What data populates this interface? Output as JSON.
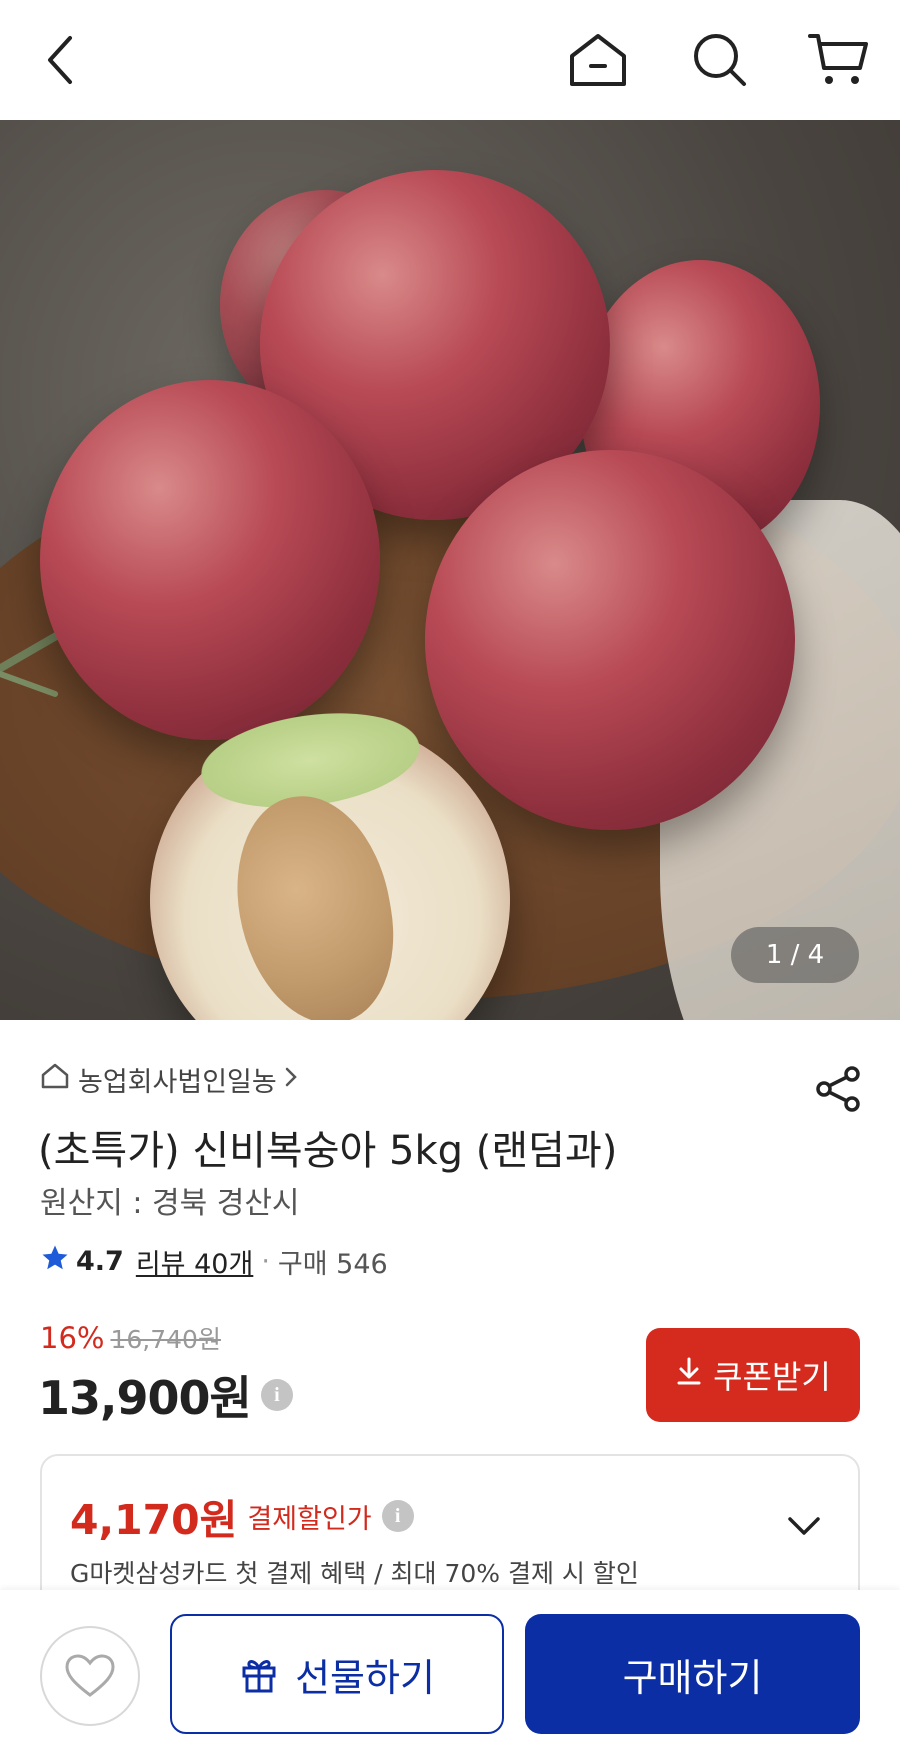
{
  "header": {
    "icons": [
      "back-arrow-icon",
      "home-icon",
      "search-icon",
      "cart-icon"
    ]
  },
  "gallery": {
    "counter": "1 / 4"
  },
  "product": {
    "seller": "농업회사법인일농",
    "title": "(초특가) 신비복숭아 5kg (랜덤과)",
    "origin": "원산지 : 경북 경산시",
    "rating": "4.7",
    "review_link": "리뷰 40개",
    "separator": "·",
    "sales": "구매 546",
    "discount_pct": "16%",
    "original_price": "16,740원",
    "price": "13,900원",
    "info_glyph": "i"
  },
  "coupon": {
    "label": "쿠폰받기"
  },
  "payment": {
    "price": "4,170원",
    "label": "결제할인가",
    "description": "G마켓삼성카드 첫 결제 혜택 / 최대 70% 결제 시 할인"
  },
  "actions": {
    "gift_label": "선물하기",
    "buy_label": "구매하기"
  },
  "colors": {
    "accent_red": "#d52b1e",
    "brand_blue": "#0b2ea5"
  }
}
